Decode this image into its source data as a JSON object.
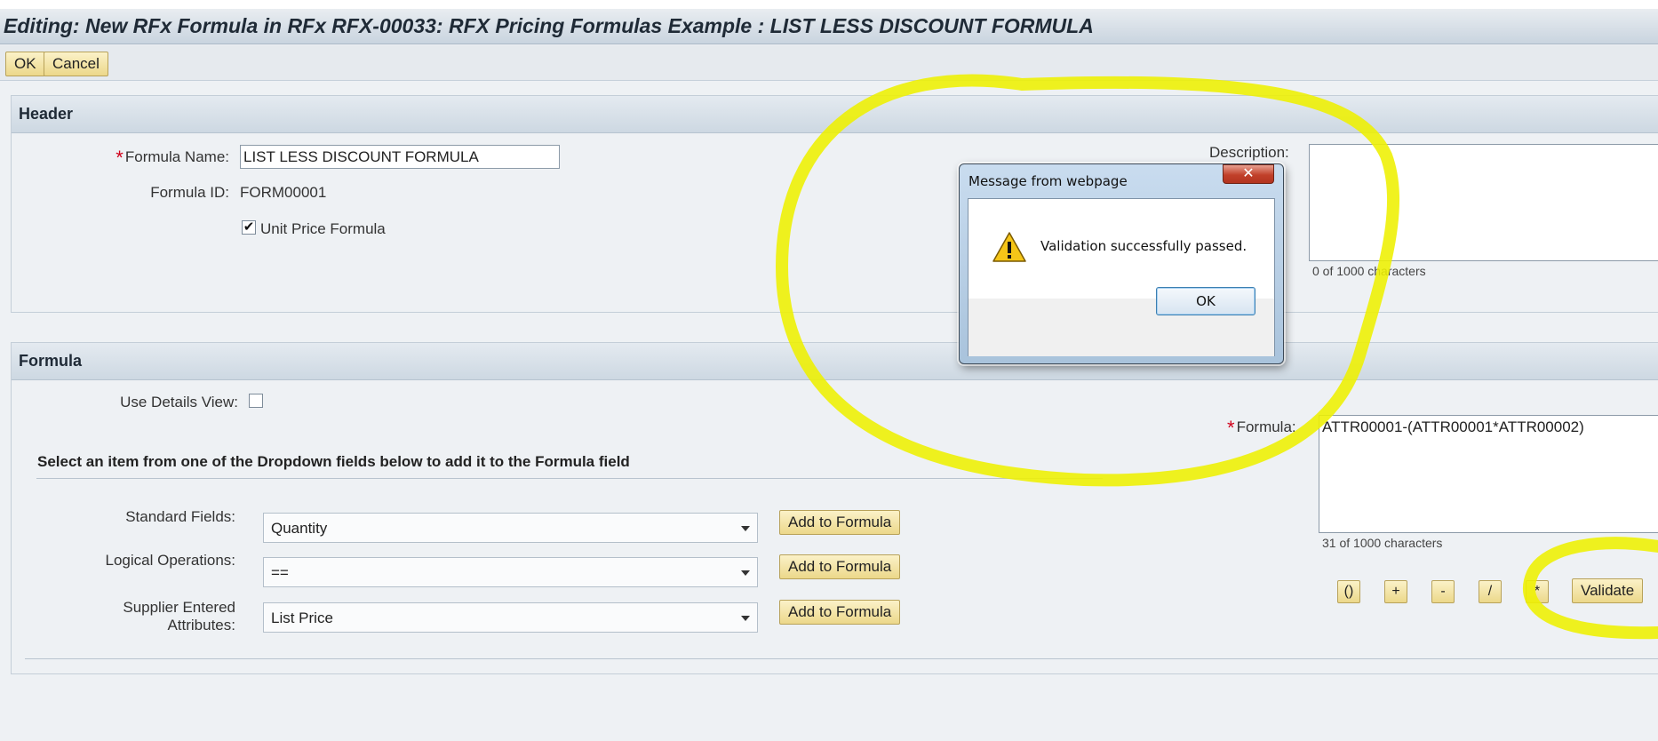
{
  "page": {
    "title": "Editing: New RFx Formula in RFx RFX-00033: RFX Pricing Formulas Example : LIST LESS DISCOUNT FORMULA"
  },
  "toolbar": {
    "ok_label": "OK",
    "cancel_label": "Cancel"
  },
  "header_section": {
    "title": "Header",
    "formula_name_label": "Formula Name:",
    "formula_name_value": "LIST LESS DISCOUNT FORMULA",
    "formula_id_label": "Formula ID:",
    "formula_id_value": "FORM00001",
    "unit_price_label": "Unit Price Formula",
    "unit_price_checked": true,
    "description_label": "Description:",
    "description_value": "",
    "description_count": "0 of 1000 characters"
  },
  "formula_section": {
    "title": "Formula",
    "use_details_label": "Use Details View:",
    "use_details_checked": false,
    "instruction": "Select an item from one of the Dropdown fields below to add it to the Formula field",
    "standard_fields_label": "Standard Fields:",
    "standard_fields_value": "Quantity",
    "logical_ops_label": "Logical Operations:",
    "logical_ops_value": "==",
    "supplier_attr_label_1": "Supplier Entered",
    "supplier_attr_label_2": "Attributes:",
    "supplier_attr_value": "List Price",
    "add_to_formula_label": "Add to Formula",
    "formula_label": "Formula:",
    "formula_value": "ATTR00001-(ATTR00001*ATTR00002)",
    "formula_count": "31 of 1000 characters",
    "op_buttons": [
      "()",
      "+",
      "-",
      "/",
      "*"
    ],
    "validate_label": "Validate"
  },
  "dialog": {
    "title": "Message from webpage",
    "close_glyph": "✕",
    "message": "Validation successfully passed.",
    "ok_label": "OK"
  },
  "colors": {
    "highlight": "#eef000",
    "required": "#d0021b",
    "button_fill": "#f4e4a6"
  }
}
